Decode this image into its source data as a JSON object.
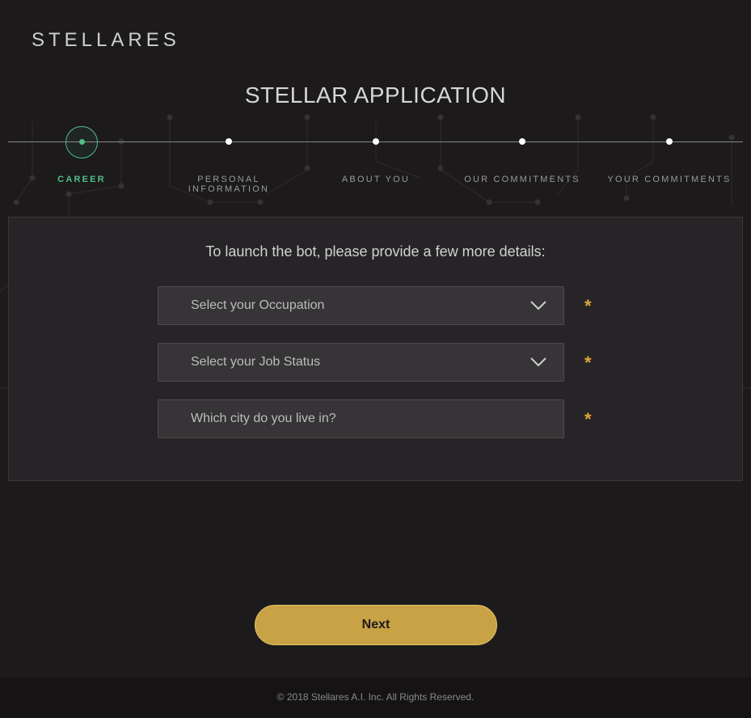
{
  "brand": {
    "logo_text": "STELLARES"
  },
  "page": {
    "title": "STELLAR APPLICATION"
  },
  "stepper": {
    "active_index": 0,
    "steps": [
      {
        "label": "CAREER"
      },
      {
        "label": "PERSONAL INFORMATION"
      },
      {
        "label": "ABOUT YOU"
      },
      {
        "label": "OUR COMMITMENTS"
      },
      {
        "label": "YOUR COMMITMENTS"
      }
    ]
  },
  "form": {
    "intro": "To launch the bot, please provide a few more details:",
    "occupation": {
      "placeholder": "Select your Occupation",
      "required_mark": "*"
    },
    "job_status": {
      "placeholder": "Select your Job Status",
      "required_mark": "*"
    },
    "city": {
      "placeholder": "Which city do you live in?",
      "required_mark": "*"
    }
  },
  "actions": {
    "next_label": "Next"
  },
  "footer": {
    "copyright": "© 2018 Stellares A.I. Inc. All Rights Reserved."
  },
  "colors": {
    "background": "#1c1a1b",
    "accent_green": "#4fbf8a",
    "accent_gold": "#c9a246",
    "required_orange": "#e0a53a"
  }
}
